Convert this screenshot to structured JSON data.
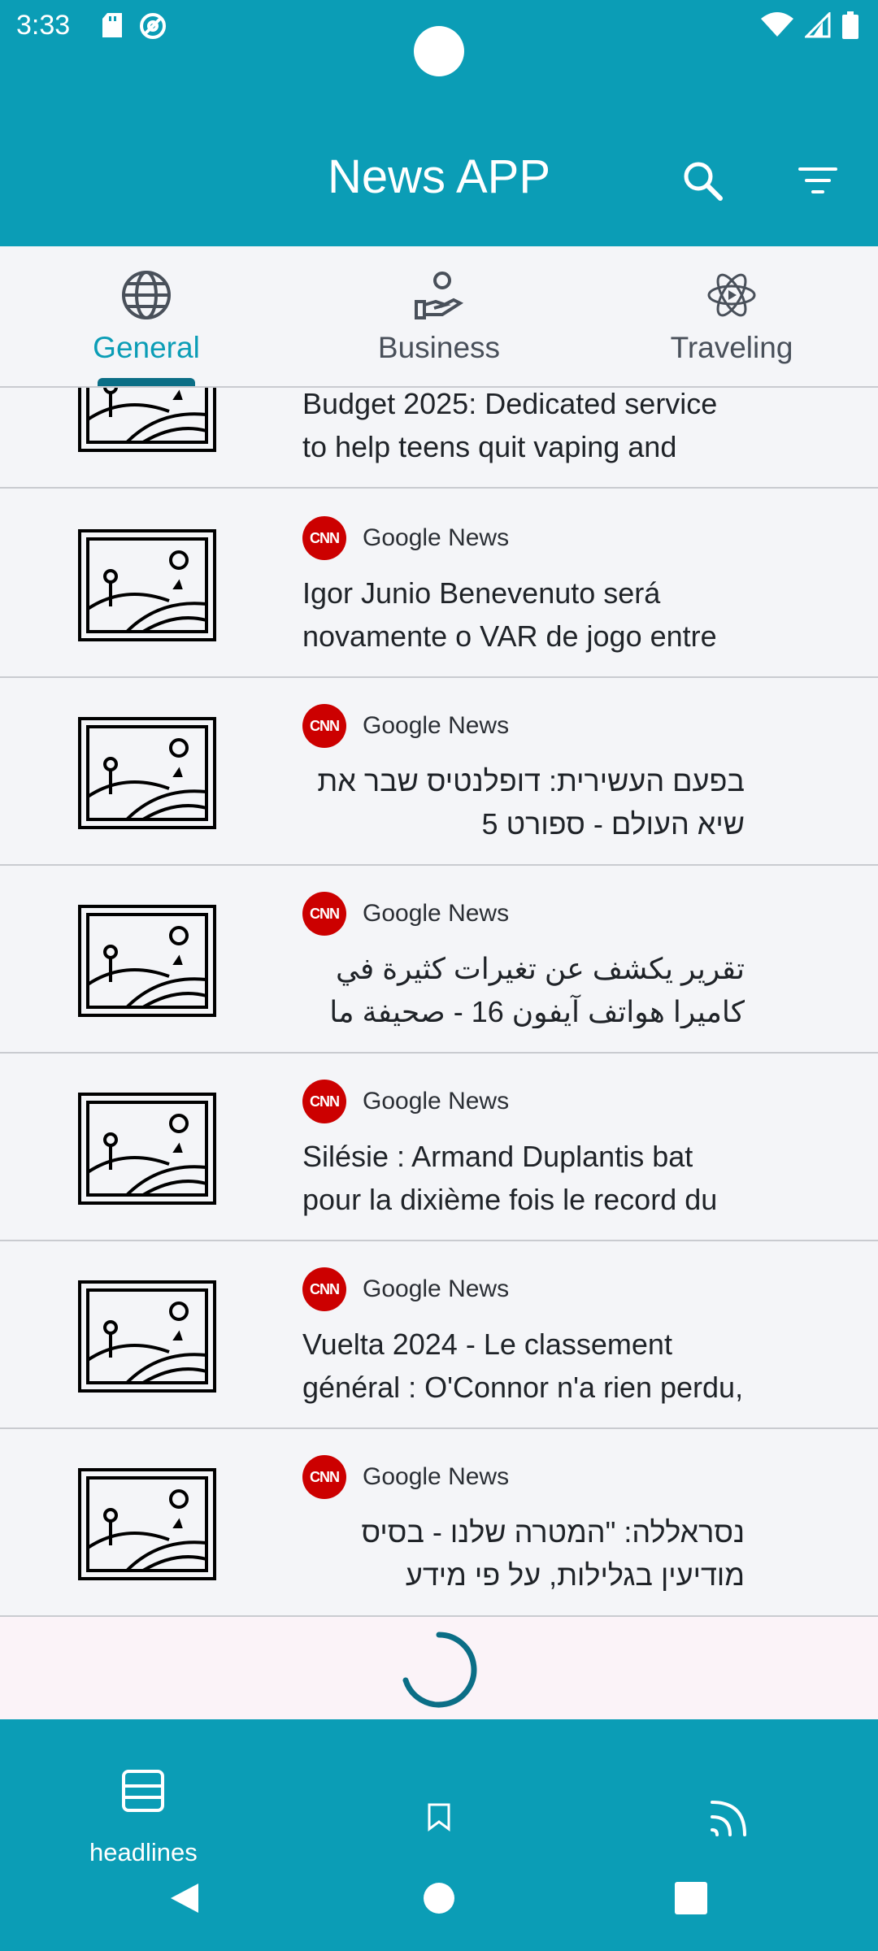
{
  "status_bar": {
    "time": "3:33"
  },
  "app_bar": {
    "title": "News APP"
  },
  "tabs": [
    {
      "label": "General",
      "icon": "globe-icon",
      "active": true
    },
    {
      "label": "Business",
      "icon": "hand-coin-icon",
      "active": false
    },
    {
      "label": "Traveling",
      "icon": "atom-icon",
      "active": false
    }
  ],
  "articles": [
    {
      "source": "",
      "headline": "Budget 2025: Dedicated service to help teens quit vaping and",
      "rtl": false
    },
    {
      "source": "Google News",
      "headline": "Igor Junio Benevenuto será novamente o VAR de jogo entre",
      "rtl": false
    },
    {
      "source": "Google News",
      "headline": "בפעם העשירית: דופלנטיס שבר את שיא העולם - ספורט 5",
      "rtl": true
    },
    {
      "source": "Google News",
      "headline": "تقرير يكشف عن تغيرات كثيرة في كاميرا هواتف آيفون 16 - صحيفة ما",
      "rtl": true
    },
    {
      "source": "Google News",
      "headline": "Silésie : Armand Duplantis bat pour la dixième fois le record du",
      "rtl": false
    },
    {
      "source": "Google News",
      "headline": "Vuelta 2024 - Le classement général : O'Connor n'a rien perdu,",
      "rtl": false
    },
    {
      "source": "Google News",
      "headline": "נסראללה: \"המטרה שלנו - בסיס מודיעין בגלילות, על פי מידע",
      "rtl": true
    }
  ],
  "source_logo_text": "CNN",
  "bottom_nav": {
    "headlines_label": "headlines",
    "items": [
      "headlines-icon",
      "bookmark-icon",
      "feed-icon"
    ]
  },
  "colors": {
    "primary": "#0b9db6",
    "accent_dark": "#0b6e86",
    "background": "#f4f5f8"
  }
}
